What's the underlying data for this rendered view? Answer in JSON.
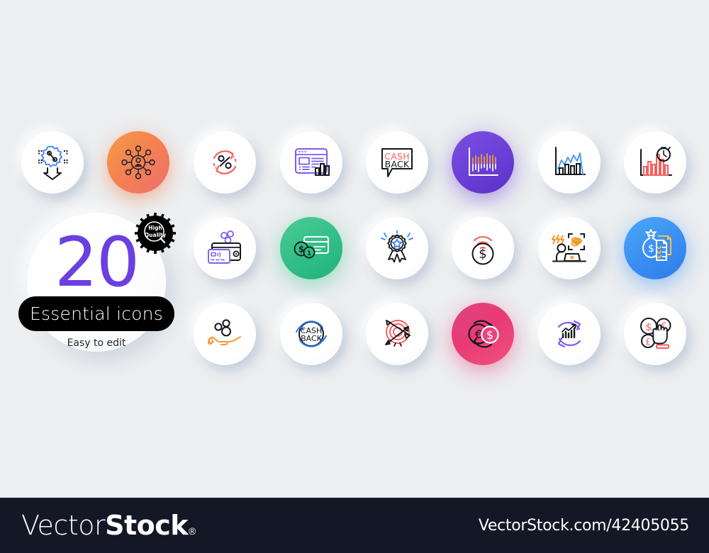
{
  "background_color": "#eceef0",
  "promo": {
    "number": "20",
    "title": "Essential icons",
    "subtitle": "Easy to edit",
    "badge_text": "High\nQuality",
    "number_color": "#6c3fe0",
    "pill_color": "#000000"
  },
  "icons": [
    {
      "name": "discount-arrow-down-icon",
      "label": "Discount",
      "row": 1,
      "col": 1,
      "style": "plain",
      "accent": "#3b82f6"
    },
    {
      "name": "user-network-icon",
      "label": "Networking",
      "row": 1,
      "col": 2,
      "style": "grad-orange",
      "accent": "#1d232b"
    },
    {
      "name": "percent-refresh-icon",
      "label": "Discount refresh",
      "row": 1,
      "col": 3,
      "style": "plain",
      "accent": "#f4605c"
    },
    {
      "name": "web-report-icon",
      "label": "Web report",
      "row": 1,
      "col": 4,
      "style": "plain",
      "accent": "#7c5cf0"
    },
    {
      "name": "cashback-speech-icon",
      "label": "CASH BACK",
      "row": 1,
      "col": 5,
      "style": "plain",
      "accent": "#f4605c"
    },
    {
      "name": "stock-bars-icon",
      "label": "Stock market",
      "row": 1,
      "col": 6,
      "style": "grad-purple",
      "accent": "#f5a13c"
    },
    {
      "name": "infographic-graph-icon",
      "label": "Infographical chart",
      "row": 1,
      "col": 7,
      "style": "plain",
      "accent": "#4a9cf0"
    },
    {
      "name": "report-timer-icon",
      "label": "Report timer",
      "row": 1,
      "col": 8,
      "style": "plain",
      "accent": "#f4605c"
    },
    {
      "name": "wallet-card-icon",
      "label": "Wallet money",
      "row": 2,
      "col": 3,
      "style": "plain",
      "accent": "#7c5cf0"
    },
    {
      "name": "payment-card-icon",
      "label": "Payment card",
      "row": 2,
      "col": 4,
      "style": "grad-green",
      "accent": "#ffffff"
    },
    {
      "name": "star-award-icon",
      "label": "Award star",
      "row": 2,
      "col": 5,
      "style": "plain",
      "accent": "#3b82f6"
    },
    {
      "name": "contactless-payment-icon",
      "label": "Contactless payment",
      "row": 2,
      "col": 6,
      "style": "plain",
      "accent": "#f4605c"
    },
    {
      "name": "difficult-stress-icon",
      "label": "Difficult stress",
      "row": 2,
      "col": 7,
      "style": "plain",
      "accent": "#f5961e"
    },
    {
      "name": "money-bag-checklist-icon",
      "label": "Budget accounting",
      "row": 2,
      "col": 8,
      "style": "grad-blue",
      "accent": "#f5c04a"
    },
    {
      "name": "hand-coins-icon",
      "label": "Receive money",
      "row": 3,
      "col": 3,
      "style": "plain",
      "accent": "#f59b3c"
    },
    {
      "name": "cashback-circle-icon",
      "label": "CASH BACK",
      "row": 3,
      "col": 4,
      "style": "plain",
      "accent": "#2f7ce8"
    },
    {
      "name": "target-arrows-icon",
      "label": "Targeting",
      "row": 3,
      "col": 5,
      "style": "plain",
      "accent": "#f4605c"
    },
    {
      "name": "currency-exchange-icon",
      "label": "Currency exchange",
      "row": 3,
      "col": 6,
      "style": "grad-pink",
      "accent": "#ffffff"
    },
    {
      "name": "chart-refresh-icon",
      "label": "Market analysis",
      "row": 3,
      "col": 7,
      "style": "plain",
      "accent": "#7c5cf0"
    },
    {
      "name": "select-currency-icon",
      "label": "Select currency",
      "row": 3,
      "col": 8,
      "style": "plain",
      "accent": "#f4605c"
    }
  ],
  "footer": {
    "brand_light": "Vector",
    "brand_bold": "Stock",
    "registered_mark": "®",
    "url": "VectorStock.com/42405055",
    "background_color": "#141726"
  }
}
